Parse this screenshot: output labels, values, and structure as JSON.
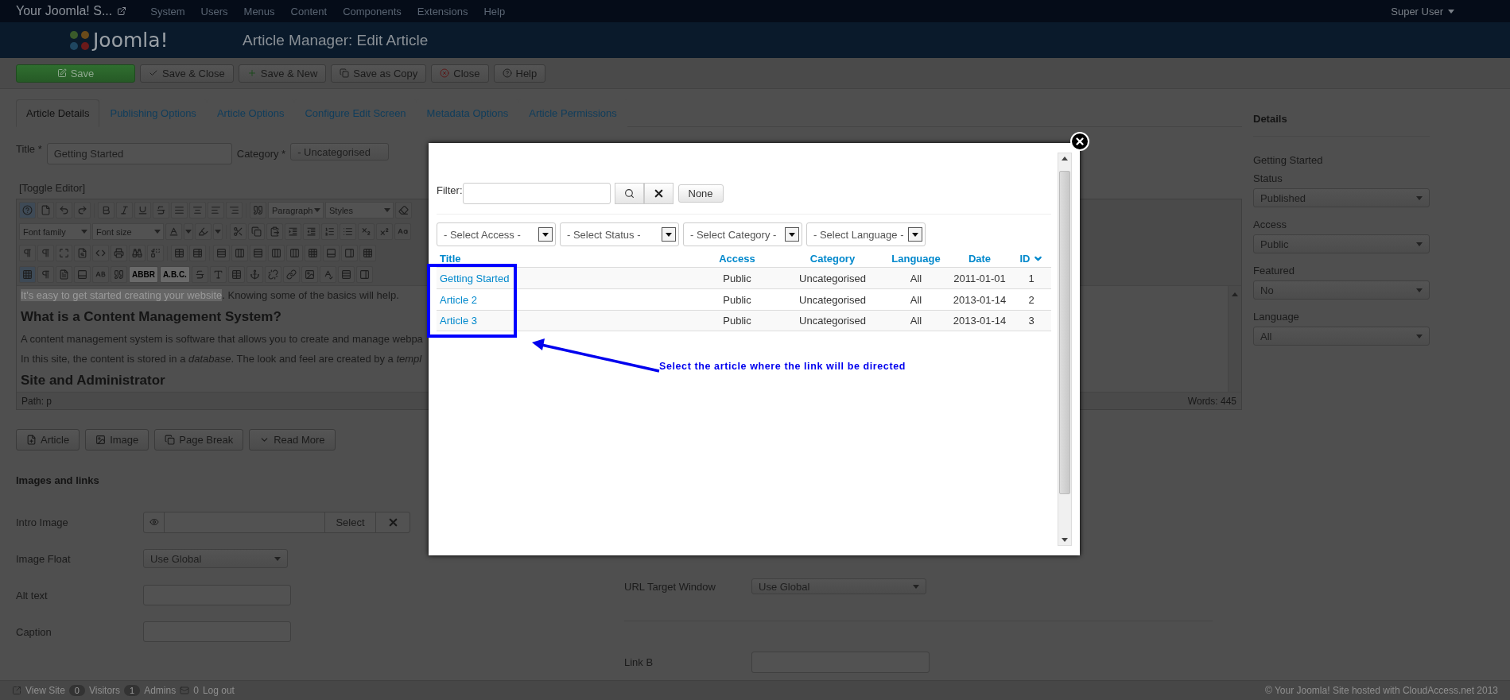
{
  "topbar": {
    "site_title": "Your Joomla! S...",
    "menus": [
      "System",
      "Users",
      "Menus",
      "Content",
      "Components",
      "Extensions",
      "Help"
    ],
    "user": "Super User"
  },
  "header": {
    "logo_text": "Joomla!",
    "title": "Article Manager: Edit Article"
  },
  "toolbar": [
    {
      "label": "Save",
      "kind": "primary"
    },
    {
      "label": "Save & Close",
      "kind": "default"
    },
    {
      "label": "Save & New",
      "kind": "default"
    },
    {
      "label": "Save as Copy",
      "kind": "default"
    },
    {
      "label": "Close",
      "kind": "default"
    },
    {
      "label": "Help",
      "kind": "default"
    }
  ],
  "tabs": [
    {
      "label": "Article Details",
      "selected": true
    },
    {
      "label": "Publishing Options",
      "selected": false
    },
    {
      "label": "Article Options",
      "selected": false
    },
    {
      "label": "Configure Edit Screen",
      "selected": false
    },
    {
      "label": "Metadata Options",
      "selected": false
    },
    {
      "label": "Article Permissions",
      "selected": false
    }
  ],
  "title_field": {
    "label": "Title *",
    "value": "Getting Started"
  },
  "category_field": {
    "label": "Category *",
    "value": "- Uncategorised"
  },
  "editor": {
    "toggle": "[Toggle Editor]",
    "format_select": "Paragraph",
    "styles_select": "Styles",
    "font_family": "Font family",
    "font_size": "Font size",
    "text_tools": [
      "ABBR",
      "A.B.C."
    ],
    "selected_text": "It's easy to get started creating your website",
    "paragraph_rest": ". Knowing some of the basics will help.",
    "heading": "What is a Content Management System?",
    "paragraphs": [
      "A content management system is software that allows you to create and manage webpa",
      "In this site, the content is stored in a *database*. The look and feel are created by a *templ*"
    ],
    "heading_2": "Site and Administrator",
    "path": "Path: p",
    "words": "Words: 445"
  },
  "editor_buttons": [
    "Article",
    "Image",
    "Page Break",
    "Read More"
  ],
  "images_links": {
    "heading": "Images and links",
    "intro_image": {
      "label": "Intro Image",
      "button": "Select"
    },
    "image_float": {
      "label": "Image Float",
      "value": "Use Global"
    },
    "alt_text": {
      "label": "Alt text"
    },
    "caption": {
      "label": "Caption"
    }
  },
  "links": {
    "url_target": {
      "label": "URL Target Window",
      "value": "Use Global"
    },
    "link_b": {
      "label": "Link B"
    }
  },
  "details": {
    "heading": "Details",
    "title": "Getting Started",
    "fields": [
      {
        "label": "Status",
        "value": "Published"
      },
      {
        "label": "Access",
        "value": "Public"
      },
      {
        "label": "Featured",
        "value": "No"
      },
      {
        "label": "Language",
        "value": "All"
      }
    ]
  },
  "status_bar": {
    "view_site": "View Site",
    "visitors_count": "0",
    "visitors": "Visitors",
    "admins_count": "1",
    "admins": "Admins",
    "messages_count": "0",
    "logout": "Log out",
    "copyright": "© Your Joomla! Site hosted with CloudAccess.net 2013"
  },
  "modal": {
    "filter_label": "Filter:",
    "none_button": "None",
    "selects": [
      "- Select Access -",
      "- Select Status -",
      "- Select Category -",
      "- Select Language -"
    ],
    "columns": [
      "Title",
      "Access",
      "Category",
      "Language",
      "Date",
      "ID"
    ],
    "rows": [
      {
        "title": "Getting Started",
        "access": "Public",
        "category": "Uncategorised",
        "language": "All",
        "date": "2011-01-01",
        "id": "1"
      },
      {
        "title": "Article 2",
        "access": "Public",
        "category": "Uncategorised",
        "language": "All",
        "date": "2013-01-14",
        "id": "2"
      },
      {
        "title": "Article 3",
        "access": "Public",
        "category": "Uncategorised",
        "language": "All",
        "date": "2013-01-14",
        "id": "3"
      }
    ],
    "annotation": "Select the article where the link will be directed"
  }
}
